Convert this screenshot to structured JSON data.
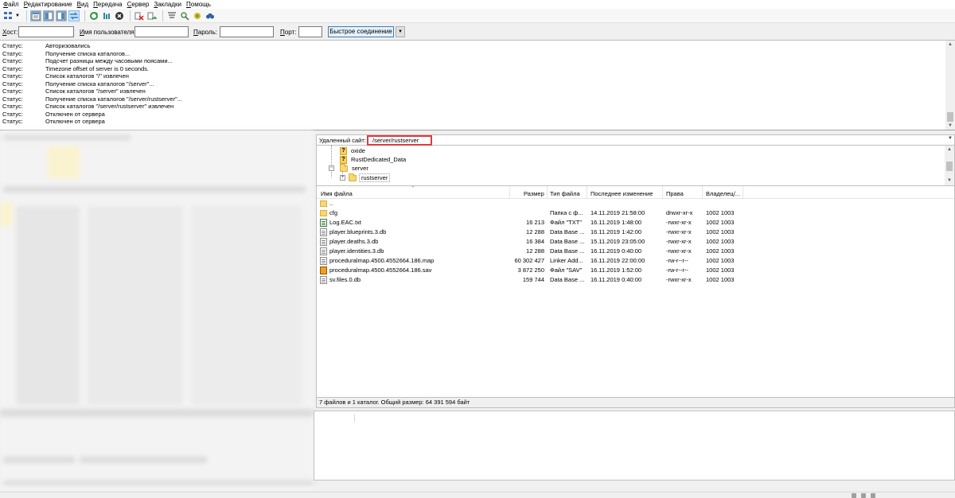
{
  "menu": [
    "Файл",
    "Редактирование",
    "Вид",
    "Передача",
    "Сервер",
    "Закладки",
    "Помощь"
  ],
  "toolbar_icons": [
    "site-manager-icon",
    "toggle-log-icon",
    "toggle-local-tree-icon",
    "toggle-remote-tree-icon",
    "toggle-queue-icon",
    "refresh-icon",
    "process-queue-icon",
    "cancel-icon",
    "disconnect-icon",
    "reconnect-icon",
    "filter-icon",
    "compare-icon",
    "sync-browse-icon",
    "search-icon"
  ],
  "quickconnect": {
    "host_label": "Хост:",
    "user_label": "Имя пользователя:",
    "pass_label": "Пароль:",
    "port_label": "Порт:",
    "host": "",
    "user": "",
    "pass": "",
    "port": "",
    "connect_label": "Быстрое соединение"
  },
  "log": [
    {
      "k": "Статус:",
      "v": "Авторизовались"
    },
    {
      "k": "Статус:",
      "v": "Получение списка каталогов..."
    },
    {
      "k": "Статус:",
      "v": "Подсчет разницы между часовыми поясами..."
    },
    {
      "k": "Статус:",
      "v": "Timezone offset of server is 0 seconds."
    },
    {
      "k": "Статус:",
      "v": "Список каталогов \"/\" извлечен"
    },
    {
      "k": "Статус:",
      "v": "Получение списка каталогов \"/server\"..."
    },
    {
      "k": "Статус:",
      "v": "Список каталогов \"/server\" извлечен"
    },
    {
      "k": "Статус:",
      "v": "Получение списка каталогов \"/server/rustserver\"..."
    },
    {
      "k": "Статус:",
      "v": "Список каталогов \"/server/rustserver\" извлечен"
    },
    {
      "k": "Статус:",
      "v": "Отключен от сервера"
    },
    {
      "k": "Статус:",
      "v": "Отключен от сервера"
    }
  ],
  "remote": {
    "label": "Удаленный сайт:",
    "path": "/server/rustserver"
  },
  "tree": [
    "oxide",
    "RustDedicated_Data",
    "server",
    "rustserver"
  ],
  "columns": [
    "Имя файла",
    "Размер",
    "Тип файла",
    "Последнее изменение",
    "Права",
    "Владелец/..."
  ],
  "files": [
    {
      "name": "..",
      "size": "",
      "type": "",
      "modified": "",
      "perms": "",
      "owner": "",
      "icon": "folder"
    },
    {
      "name": "cfg",
      "size": "",
      "type": "Папка с ф...",
      "modified": "14.11.2019 21:58:00",
      "perms": "drwxr-xr-x",
      "owner": "1002 1003",
      "icon": "folder"
    },
    {
      "name": "Log.EAC.txt",
      "size": "16 213",
      "type": "Файл \"TXT\"",
      "modified": "16.11.2019 1:48:00",
      "perms": "-rwxr-xr-x",
      "owner": "1002 1003",
      "icon": "txt"
    },
    {
      "name": "player.blueprints.3.db",
      "size": "12 288",
      "type": "Data Base ...",
      "modified": "16.11.2019 1:42:00",
      "perms": "-rwxr-xr-x",
      "owner": "1002 1003",
      "icon": "doc"
    },
    {
      "name": "player.deaths.3.db",
      "size": "16 384",
      "type": "Data Base ...",
      "modified": "15.11.2019 23:05:00",
      "perms": "-rwxr-xr-x",
      "owner": "1002 1003",
      "icon": "doc"
    },
    {
      "name": "player.identities.3.db",
      "size": "12 288",
      "type": "Data Base ...",
      "modified": "16.11.2019 0:40:00",
      "perms": "-rwxr-xr-x",
      "owner": "1002 1003",
      "icon": "doc"
    },
    {
      "name": "proceduralmap.4500.4552664.186.map",
      "size": "60 302 427",
      "type": "Linker Add...",
      "modified": "16.11.2019 22:00:00",
      "perms": "-rw-r--r--",
      "owner": "1002 1003",
      "icon": "doc"
    },
    {
      "name": "proceduralmap.4500.4552664.186.sav",
      "size": "3 872 250",
      "type": "Файл \"SAV\"",
      "modified": "16.11.2019 1:52:00",
      "perms": "-rw-r--r--",
      "owner": "1002 1003",
      "icon": "sav"
    },
    {
      "name": "sv.files.0.db",
      "size": "159 744",
      "type": "Data Base ...",
      "modified": "16.11.2019 0:40:00",
      "perms": "-rwxr-xr-x",
      "owner": "1002 1003",
      "icon": "doc"
    }
  ],
  "summary": "7 файлов и 1 каталог. Общий размер: 64 391 594 байт"
}
